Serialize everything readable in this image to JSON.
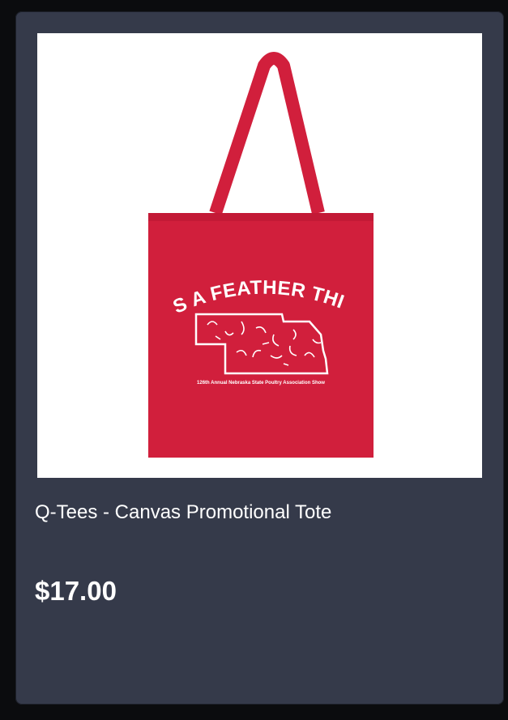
{
  "product": {
    "title": "Q-Tees - Canvas Promotional Tote",
    "price": "$17.00",
    "image": {
      "subject": "red-canvas-tote-bag",
      "print_headline": "IT'S A FEATHER THING",
      "print_caption": "126th Annual Nebraska State Poultry Association Show"
    }
  },
  "colors": {
    "card_background": "#353a4a",
    "tote_red": "#d11f3c",
    "image_background": "#ffffff",
    "text": "#ffffff"
  }
}
